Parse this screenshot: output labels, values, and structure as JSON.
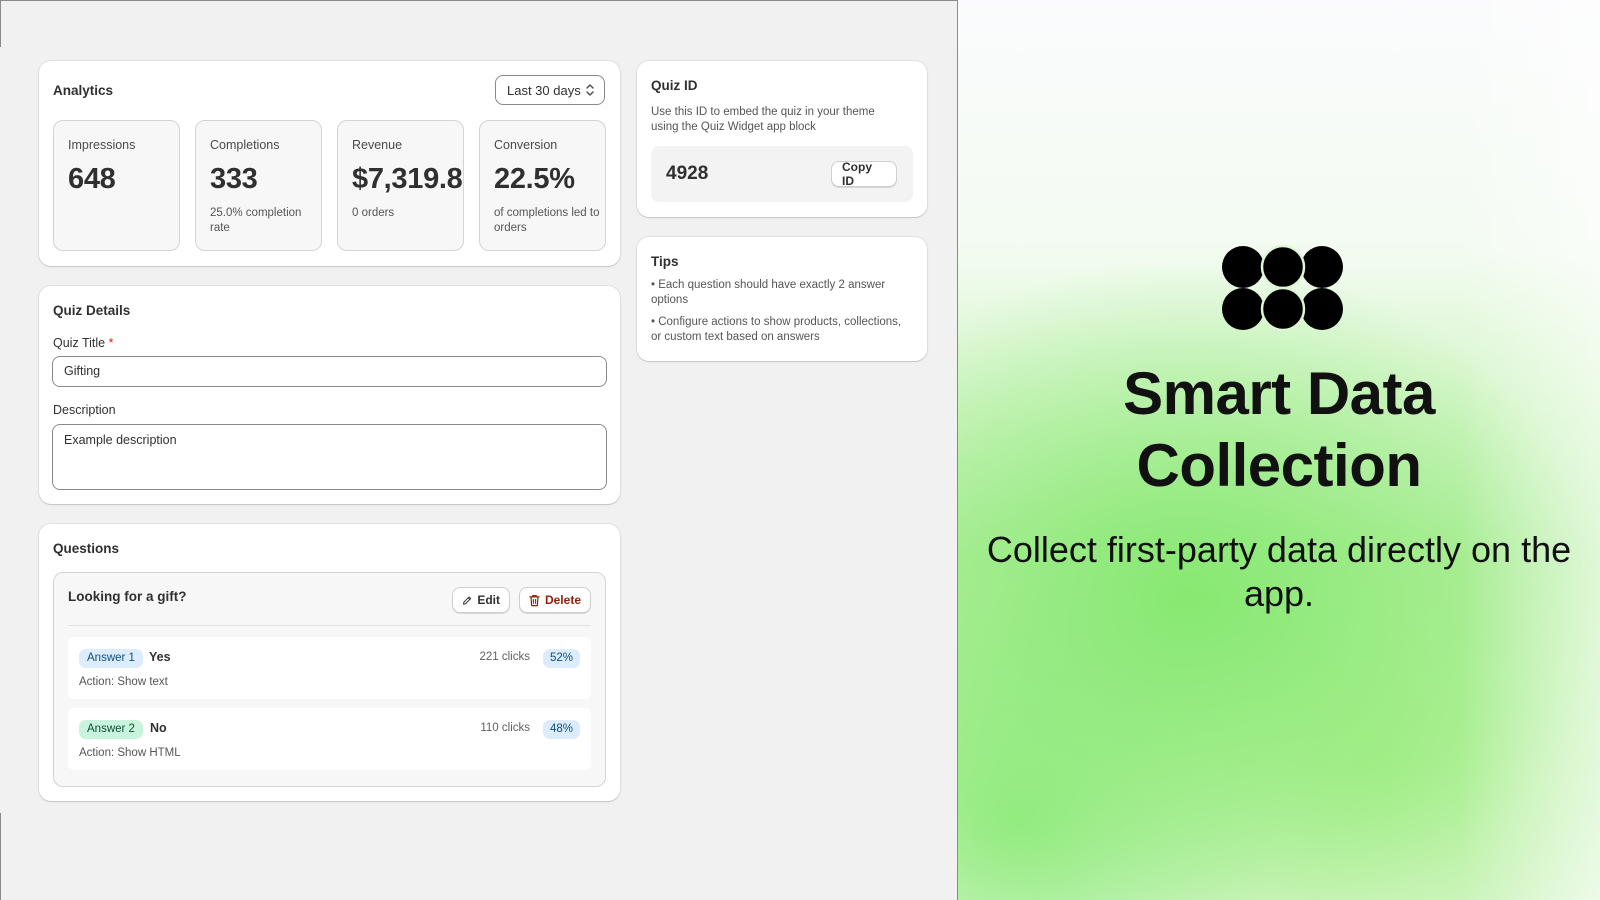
{
  "analytics": {
    "title": "Analytics",
    "date_range": "Last 30 days",
    "stats": [
      {
        "label": "Impressions",
        "value": "648",
        "sub": ""
      },
      {
        "label": "Completions",
        "value": "333",
        "sub": "25.0% completion rate"
      },
      {
        "label": "Revenue",
        "value": "$7,319.8",
        "sub": "0 orders"
      },
      {
        "label": "Conversion",
        "value": "22.5%",
        "sub": "of completions led to orders"
      }
    ]
  },
  "details": {
    "title": "Quiz Details",
    "quiz_title_label": "Quiz Title",
    "required_mark": "*",
    "quiz_title_value": "Gifting",
    "description_label": "Description",
    "description_value": "Example description"
  },
  "questions": {
    "title": "Questions",
    "items": [
      {
        "question": "Looking for a gift?",
        "edit_label": "Edit",
        "delete_label": "Delete",
        "answers": [
          {
            "badge": "Answer 1",
            "text": "Yes",
            "action": "Action: Show text",
            "clicks": "221 clicks",
            "percent": "52%"
          },
          {
            "badge": "Answer 2",
            "text": "No",
            "action": "Action: Show HTML",
            "clicks": "110 clicks",
            "percent": "48%"
          }
        ]
      }
    ]
  },
  "quiz_id": {
    "title": "Quiz ID",
    "help": "Use this ID to embed the quiz in your theme using the Quiz Widget app block",
    "value": "4928",
    "copy_label": "Copy ID"
  },
  "tips": {
    "title": "Tips",
    "items": [
      "• Each question should have exactly 2 answer options",
      "• Configure actions to show products, collections, or custom text based on answers"
    ]
  },
  "promo": {
    "title_line1": "Smart Data",
    "title_line2": "Collection",
    "subtitle": "Collect first-party data directly on the app."
  },
  "colors": {
    "app_bg": "#f1f1f1",
    "card_bg": "#ffffff",
    "answer1_badge": "#dcecfd",
    "answer2_badge": "#c9f4dc",
    "delete_text": "#8e1f0b",
    "promo_green": "#9be88a"
  },
  "icons": {
    "chevron": "chevron-up-down-icon",
    "edit": "pencil-icon",
    "delete": "trash-icon",
    "logo": "four-circle-logo"
  }
}
